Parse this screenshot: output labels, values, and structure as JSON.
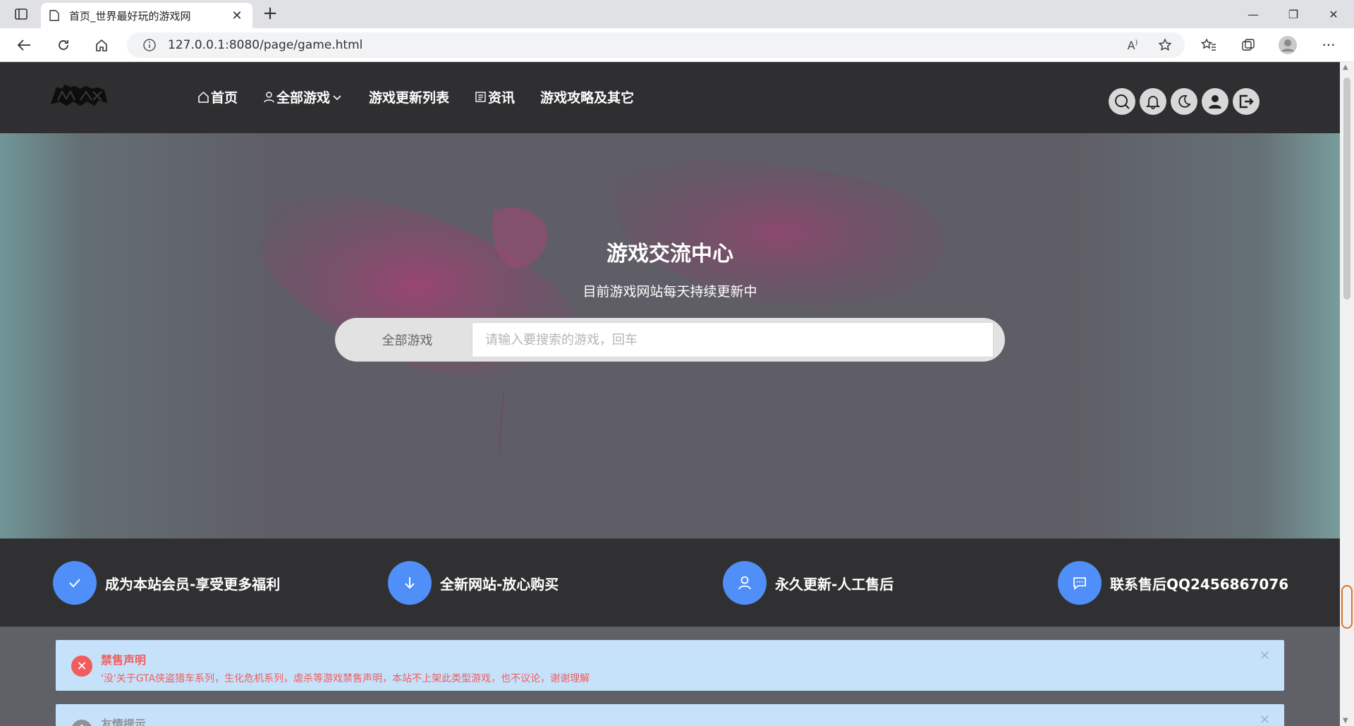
{
  "browser": {
    "tab_title": "首页_世界最好玩的游戏网",
    "url": "127.0.0.1:8080/page/game.html"
  },
  "nav": {
    "home": "首页",
    "all_games": "全部游戏",
    "updates": "游戏更新列表",
    "news": "资讯",
    "guides": "游戏攻略及其它"
  },
  "hero": {
    "title": "游戏交流中心",
    "subtitle": "目前游戏网站每天持续更新中",
    "search_category": "全部游戏",
    "search_placeholder": "请输入要搜索的游戏，回车"
  },
  "features": [
    {
      "text": "成为本站会员-享受更多福利",
      "icon": "check-icon"
    },
    {
      "text": "全新网站-放心购买",
      "icon": "arrow-down-icon"
    },
    {
      "text": "永久更新-人工售后",
      "icon": "user-icon"
    },
    {
      "text": "联系售后QQ2456867076",
      "icon": "message-icon"
    }
  ],
  "notices": [
    {
      "title": "禁售声明",
      "body": "'没'关于GTA侠盗猎车系列，生化危机系列，虐杀等游戏禁售声明，本站不上架此类型游戏，也不议论，谢谢理解",
      "color": "#f25c5c"
    },
    {
      "title": "友情提示",
      "body": "",
      "color": "#909399"
    }
  ],
  "colors": {
    "header_bg": "#2f2f31",
    "accent_blue": "#4f8ff7",
    "notice_bg": "#c6e2fb",
    "error_red": "#f25c5c"
  }
}
